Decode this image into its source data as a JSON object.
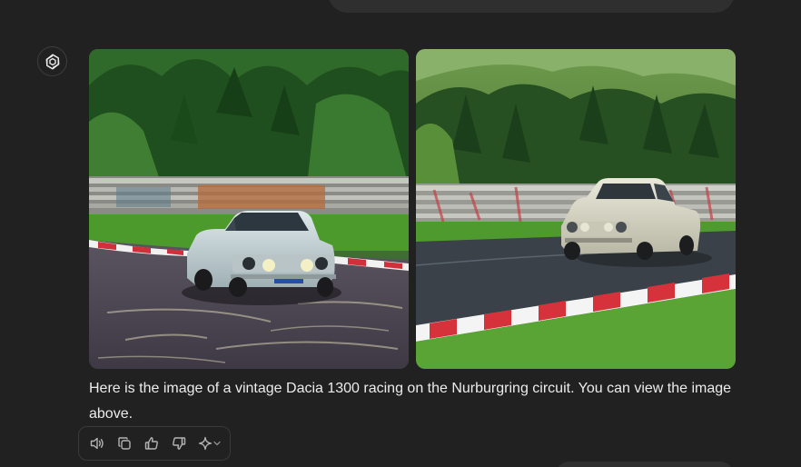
{
  "message": {
    "text": "Here is the image of a vintage Dacia 1300 racing on the Nurburgring circuit. You can view the image above."
  },
  "icons": {
    "assistant_avatar": "openai-logo-icon",
    "read_aloud": "speaker-icon",
    "copy": "copy-icon",
    "good_response": "thumbs-up-icon",
    "bad_response": "thumbs-down-icon",
    "regenerate": "sparkle-icon",
    "model_menu": "chevron-down-icon"
  },
  "colors": {
    "background": "#212121",
    "text": "#ececec",
    "icon": "#b4b4b4",
    "border": "#3a3a3a"
  }
}
